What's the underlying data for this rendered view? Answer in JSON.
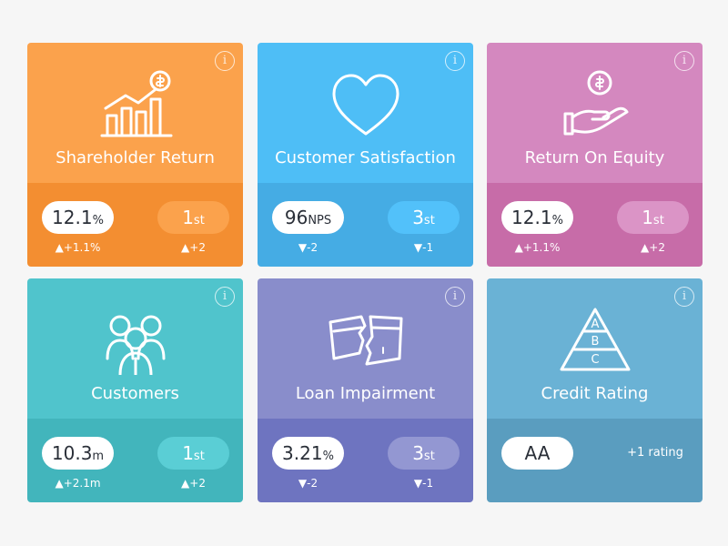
{
  "cards": [
    {
      "title": "Shareholder Return",
      "icon": "bar-chart-dollar-icon",
      "value": "12.1",
      "unit": "%",
      "rank": "1",
      "rank_suffix": "st",
      "value_delta": "▲+1.1%",
      "rank_delta": "▲+2",
      "colors": {
        "top": "#FBA24C",
        "bottom": "#F38E31",
        "pill": "#FBA24C"
      }
    },
    {
      "title": "Customer Satisfaction",
      "icon": "heart-icon",
      "value": "96",
      "unit": "NPS",
      "rank": "3",
      "rank_suffix": "st",
      "value_delta": "▼-2",
      "rank_delta": "▼-1",
      "colors": {
        "top": "#4EBEF6",
        "bottom": "#45ACE4",
        "pill": "#52C1FA"
      }
    },
    {
      "title": "Return On Equity",
      "icon": "hand-coin-icon",
      "value": "12.1",
      "unit": "%",
      "rank": "1",
      "rank_suffix": "st",
      "value_delta": "▲+1.1%",
      "rank_delta": "▲+2",
      "colors": {
        "top": "#D488BF",
        "bottom": "#C76CA8",
        "pill": "#DB94C6"
      }
    },
    {
      "title": "Customers",
      "icon": "people-group-icon",
      "value": "10.3",
      "unit": "m",
      "rank": "1",
      "rank_suffix": "st",
      "value_delta": "▲+2.1m",
      "rank_delta": "▲+2",
      "colors": {
        "top": "#50C4CC",
        "bottom": "#42B5BC",
        "pill": "#5ACED5"
      }
    },
    {
      "title": "Loan Impairment",
      "icon": "broken-card-icon",
      "value": "3.21",
      "unit": "%",
      "rank": "3",
      "rank_suffix": "st",
      "value_delta": "▼-2",
      "rank_delta": "▼-1",
      "colors": {
        "top": "#898DCB",
        "bottom": "#6E74C0",
        "pill": "#9397D2"
      }
    },
    {
      "title": "Credit Rating",
      "icon": "pyramid-abc-icon",
      "value": "AA",
      "note": "+1 rating",
      "colors": {
        "top": "#6AB2D5",
        "bottom": "#5A9DBF"
      }
    }
  ],
  "info_label": "i",
  "pyramid_labels": [
    "A",
    "B",
    "C"
  ]
}
